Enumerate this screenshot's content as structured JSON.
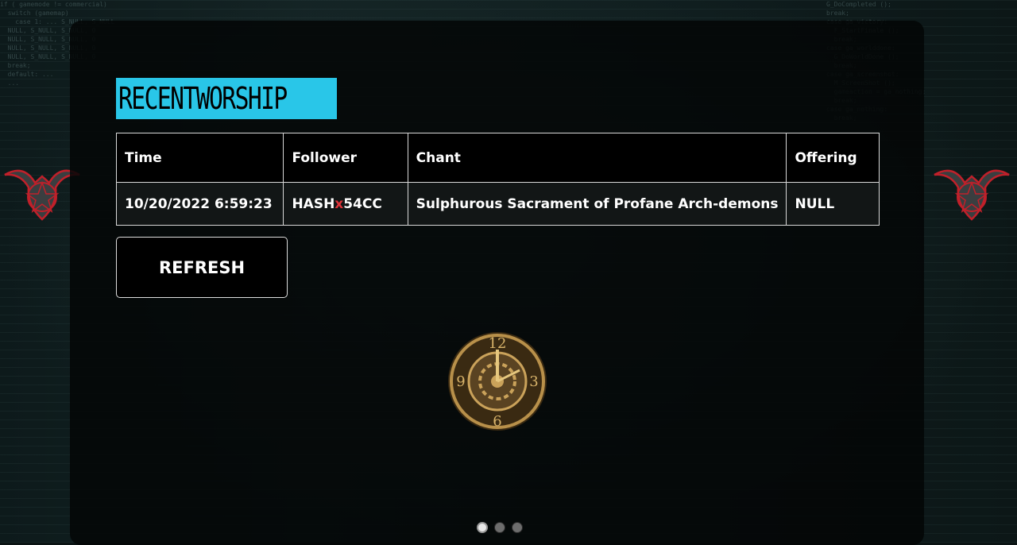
{
  "page_title": "RECENTWORSHIP",
  "table": {
    "columns": [
      "Time",
      "Follower",
      "Chant",
      "Offering"
    ],
    "rows": [
      {
        "time": "10/20/2022 6:59:23",
        "follower_prefix": "HASH",
        "follower_mark": "x",
        "follower_suffix": "54CC",
        "chant": "Sulphurous Sacrament of Profane Arch-demons",
        "offering": "NULL"
      }
    ]
  },
  "refresh_label": "REFRESH",
  "carousel": {
    "count": 3,
    "active_index": 0
  },
  "icons": {
    "left_emblem": "horned-skull-icon",
    "right_emblem": "horned-skull-icon",
    "center_clock": "clock-icon"
  },
  "colors": {
    "title_bg": "#29c6e8",
    "follower_mark": "#e0343a",
    "emblem_glow": "#c0202a"
  }
}
